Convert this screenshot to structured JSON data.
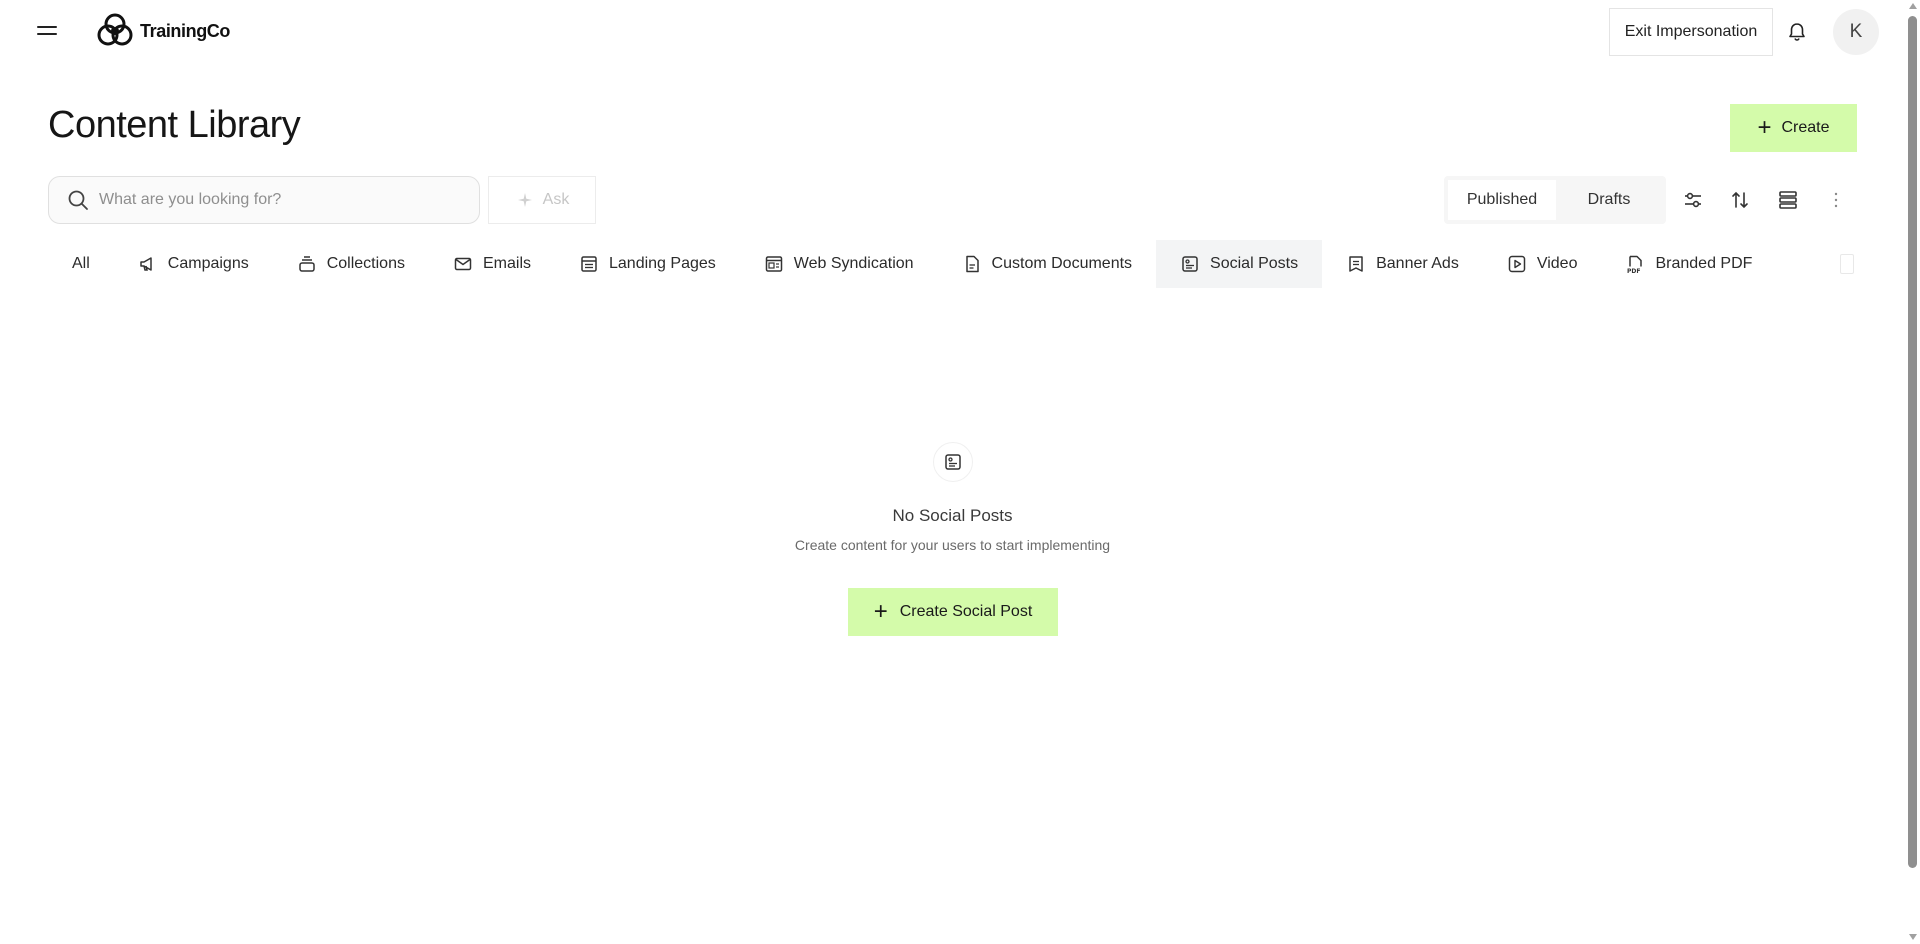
{
  "app": {
    "brand": "TrainingCo"
  },
  "header": {
    "exit_label": "Exit Impersonation",
    "avatar_initial": "K"
  },
  "page": {
    "title": "Content Library",
    "create_label": "Create"
  },
  "search": {
    "placeholder": "What are you looking for?",
    "value": "",
    "ask_label": "Ask"
  },
  "status_toggle": {
    "published": "Published",
    "drafts": "Drafts",
    "selected": "Published"
  },
  "tabs": [
    {
      "label": "All",
      "icon": "none"
    },
    {
      "label": "Campaigns",
      "icon": "megaphone-icon"
    },
    {
      "label": "Collections",
      "icon": "collections-icon"
    },
    {
      "label": "Emails",
      "icon": "envelope-icon"
    },
    {
      "label": "Landing Pages",
      "icon": "landing-page-icon"
    },
    {
      "label": "Web Syndication",
      "icon": "web-syndication-icon"
    },
    {
      "label": "Custom Documents",
      "icon": "document-icon"
    },
    {
      "label": "Social Posts",
      "icon": "social-post-icon",
      "active": true
    },
    {
      "label": "Banner Ads",
      "icon": "banner-ad-icon"
    },
    {
      "label": "Video",
      "icon": "video-icon"
    },
    {
      "label": "Branded PDF",
      "icon": "pdf-icon"
    }
  ],
  "empty_state": {
    "title": "No Social Posts",
    "subtitle": "Create content for your users to start implementing",
    "button_label": "Create Social Post",
    "icon": "social-post-icon"
  },
  "colors": {
    "accent": "#d4fbaa",
    "active_tab_bg": "#f3f4f5",
    "text": "#1f1f1f"
  }
}
